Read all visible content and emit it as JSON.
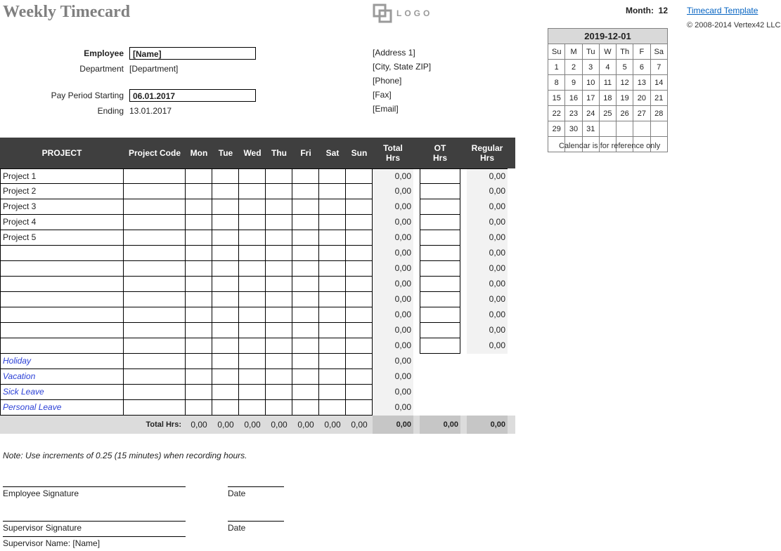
{
  "title": "Weekly Timecard",
  "logo_text": "LOGO",
  "month_label": "Month:",
  "month_value": "12",
  "link_text": "Timecard Template",
  "copyright": "© 2008-2014 Vertex42 LLC",
  "info": {
    "employee_label": "Employee",
    "employee_value": "[Name]",
    "department_label": "Department",
    "department_value": "[Department]",
    "period_start_label": "Pay Period Starting",
    "period_start_value": "06.01.2017",
    "period_end_label": "Ending",
    "period_end_value": "13.01.2017"
  },
  "address": {
    "line1": "[Address 1]",
    "line2": "[City, State  ZIP]",
    "phone": "[Phone]",
    "fax": "[Fax]",
    "email": "[Email]"
  },
  "calendar": {
    "title": "2019-12-01",
    "dows": [
      "Su",
      "M",
      "Tu",
      "W",
      "Th",
      "F",
      "Sa"
    ],
    "weeks": [
      [
        "1",
        "2",
        "3",
        "4",
        "5",
        "6",
        "7"
      ],
      [
        "8",
        "9",
        "10",
        "11",
        "12",
        "13",
        "14"
      ],
      [
        "15",
        "16",
        "17",
        "18",
        "19",
        "20",
        "21"
      ],
      [
        "22",
        "23",
        "24",
        "25",
        "26",
        "27",
        "28"
      ],
      [
        "29",
        "30",
        "31",
        "",
        "",
        "",
        ""
      ],
      [
        "",
        "",
        "",
        "",
        "",
        "",
        ""
      ]
    ],
    "note": "Calendar is for reference only"
  },
  "grid": {
    "headers": {
      "project": "PROJECT",
      "code": "Project Code",
      "days": [
        "Mon",
        "Tue",
        "Wed",
        "Thu",
        "Fri",
        "Sat",
        "Sun"
      ],
      "total": "Total\nHrs",
      "ot": "OT\nHrs",
      "regular": "Regular\nHrs"
    },
    "projects": [
      {
        "name": "Project 1",
        "total": "0,00",
        "ot": "",
        "reg": "0,00"
      },
      {
        "name": "Project 2",
        "total": "0,00",
        "ot": "",
        "reg": "0,00"
      },
      {
        "name": "Project 3",
        "total": "0,00",
        "ot": "",
        "reg": "0,00"
      },
      {
        "name": "Project 4",
        "total": "0,00",
        "ot": "",
        "reg": "0,00"
      },
      {
        "name": "Project 5",
        "total": "0,00",
        "ot": "",
        "reg": "0,00"
      },
      {
        "name": "",
        "total": "0,00",
        "ot": "",
        "reg": "0,00"
      },
      {
        "name": "",
        "total": "0,00",
        "ot": "",
        "reg": "0,00"
      },
      {
        "name": "",
        "total": "0,00",
        "ot": "",
        "reg": "0,00"
      },
      {
        "name": "",
        "total": "0,00",
        "ot": "",
        "reg": "0,00"
      },
      {
        "name": "",
        "total": "0,00",
        "ot": "",
        "reg": "0,00"
      },
      {
        "name": "",
        "total": "0,00",
        "ot": "",
        "reg": "0,00"
      },
      {
        "name": "",
        "total": "0,00",
        "ot": "",
        "reg": "0,00"
      }
    ],
    "leave": [
      {
        "name": "Holiday",
        "total": "0,00"
      },
      {
        "name": "Vacation",
        "total": "0,00"
      },
      {
        "name": "Sick Leave",
        "total": "0,00"
      },
      {
        "name": "Personal Leave",
        "total": "0,00"
      }
    ],
    "totals": {
      "label": "Total Hrs:",
      "days": [
        "0,00",
        "0,00",
        "0,00",
        "0,00",
        "0,00",
        "0,00",
        "0,00"
      ],
      "total": "0,00",
      "ot": "0,00",
      "reg": "0,00"
    }
  },
  "note": "Note: Use increments of 0.25 (15 minutes) when recording hours.",
  "sign": {
    "emp_sig": "Employee Signature",
    "date": "Date",
    "sup_sig": "Supervisor Signature",
    "sup_name": "Supervisor Name: [Name]"
  }
}
